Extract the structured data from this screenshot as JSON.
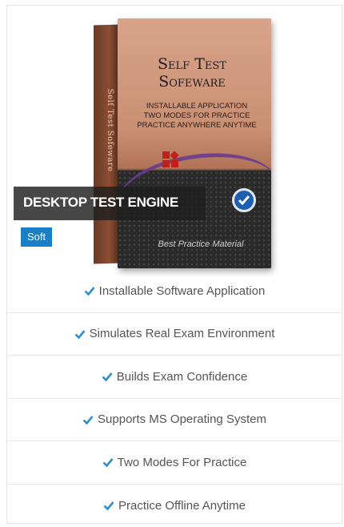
{
  "product": {
    "box_title_line1": "Self Test",
    "box_title_line2": "Sofeware",
    "box_feature_line1": "Installable Application",
    "box_feature_line2": "Two Modes For Practice",
    "box_feature_line3": "Practice Anywhere Anytime",
    "box_side_text": "Self Test Sofeware",
    "box_bottom_text": "Best Practice Material",
    "ribbon_title": "DESKTOP TEST ENGINE",
    "badge_label": "Soft"
  },
  "features": [
    {
      "label": "Installable Software Application"
    },
    {
      "label": "Simulates Real Exam Environment"
    },
    {
      "label": "Builds Exam Confidence"
    },
    {
      "label": "Supports MS Operating System"
    },
    {
      "label": "Two Modes For Practice"
    },
    {
      "label": "Practice Offline Anytime"
    }
  ],
  "colors": {
    "accent": "#1a7fc4",
    "check": "#2a8fd0",
    "text": "#555555",
    "ribbon": "#1e1e1e"
  },
  "icons": {
    "check": "check-icon",
    "badge": "checkmark-badge-icon",
    "logo": "red-squares-logo-icon"
  }
}
